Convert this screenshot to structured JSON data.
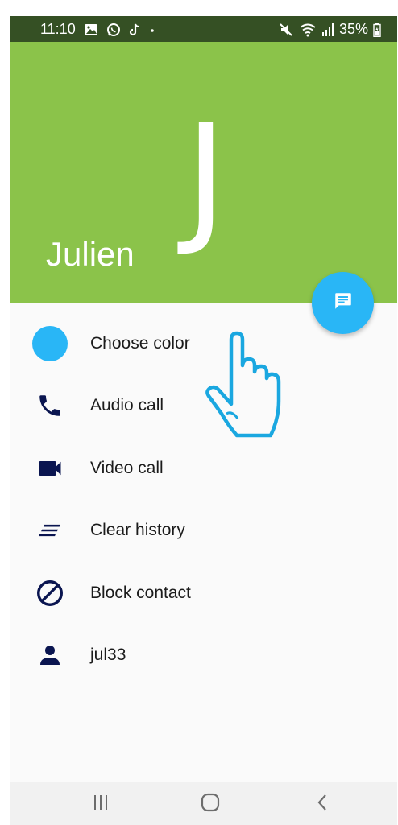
{
  "status_bar": {
    "time": "11:10",
    "battery": "35%",
    "icons": [
      "gallery-icon",
      "whatsapp-icon",
      "tiktok-icon",
      "dot-icon",
      "mute-icon",
      "wifi-icon",
      "signal-icon",
      "battery-icon"
    ]
  },
  "header": {
    "avatar_letter": "J",
    "contact_name": "Julien",
    "background_color": "#8bc34a"
  },
  "fab": {
    "icon": "message-icon",
    "color": "#29b6f6"
  },
  "menu": {
    "items": [
      {
        "label": "Choose color",
        "icon": "color-dot-icon"
      },
      {
        "label": "Audio call",
        "icon": "phone-icon"
      },
      {
        "label": "Video call",
        "icon": "video-camera-icon"
      },
      {
        "label": "Clear history",
        "icon": "clear-history-icon"
      },
      {
        "label": "Block contact",
        "icon": "block-icon"
      },
      {
        "label": "jul33",
        "icon": "person-icon"
      }
    ],
    "icon_color": "#0a1550",
    "accent_color": "#29b6f6"
  },
  "nav_bar": {
    "buttons": [
      "recents-icon",
      "home-icon",
      "back-icon"
    ]
  }
}
